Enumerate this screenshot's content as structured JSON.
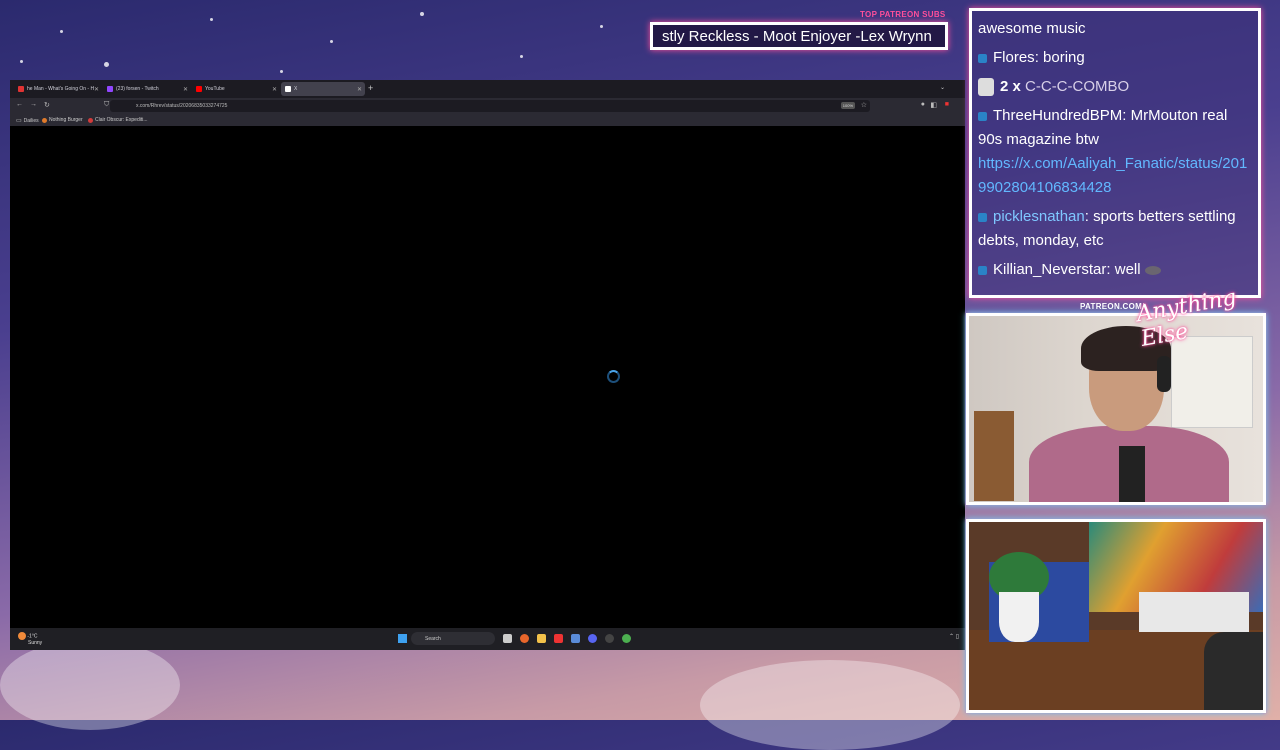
{
  "browser": {
    "tabs": [
      {
        "label": "he Man - What's Going On - H",
        "favicon_color": "#e03333",
        "active": false
      },
      {
        "label": "(23) forsen - Twitch",
        "favicon_color": "#9146ff",
        "active": false
      },
      {
        "label": "YouTube",
        "favicon_color": "#ff0000",
        "active": false
      },
      {
        "label": "X",
        "favicon_color": "#ffffff",
        "active": true
      }
    ],
    "url": "x.com/Rhrev/status/20206835033274725",
    "zoom": "100%",
    "bookmarks": [
      {
        "label": "Dailies",
        "icon_color": "#888888"
      },
      {
        "label": "Nothing Burger",
        "icon_color": "#e07a2a"
      },
      {
        "label": "Clair Obscur: Expediti...",
        "icon_color": "#d33b3b"
      }
    ],
    "taskbar": {
      "weather_temp": "-1°C",
      "weather_desc": "Sunny",
      "search_placeholder": "Search"
    }
  },
  "overlay": {
    "patreon_title": "TOP PATREON SUBS",
    "ticker_text": "stly Reckless - Moot Enjoyer -Lex Wrynn",
    "patreon_url": "PATREON.COM/",
    "logo_text": "Anything Else"
  },
  "chat": {
    "messages": [
      {
        "user": "",
        "text": "awesome music"
      },
      {
        "user": "Flores",
        "text": "boring"
      },
      {
        "combo_count": "2 x",
        "combo_text": "C-C-C-COMBO"
      },
      {
        "user": "ThreeHundredBPM",
        "text": "MrMouton real 90s magazine btw",
        "link": "https://x.com/Aaliyah_Fanatic/status/2019902804106834428"
      },
      {
        "user": "picklesnathan",
        "text": "sports betters settling debts, monday, etc"
      },
      {
        "user": "Killian_Neverstar",
        "text": "well"
      }
    ]
  },
  "colors": {
    "accent_pink": "#ff4f9a",
    "accent_cyan": "#4fe0ff",
    "chat_badge": "#2a83c7"
  }
}
